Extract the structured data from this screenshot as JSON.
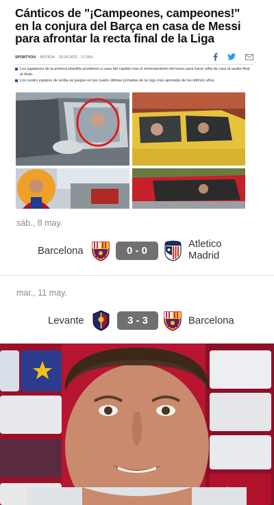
{
  "article": {
    "headline_lines": [
      "Cánticos de \"¡Campeones, campeones!\"",
      "en la conjura del Barça en casa de Messi",
      "para afrontar la recta final de la Liga"
    ],
    "source": "SPORTYOU",
    "category": "NOTICIA",
    "datetime": "03.05.2021 - 17:26H",
    "bullets": [
      "Los jugadores de la primera plantilla acudieron a casa del capitán tras el entrenamiento del lunes para hacer piña de cara al asalto final al título.",
      "Los cuatro equipos de arriba se juegan en las cuatro últimas jornadas de la Liga más apretada de los últimos años."
    ],
    "share_icons": [
      "facebook-icon",
      "twitter-icon",
      "mail-icon"
    ],
    "accent_color": "#1e4fa0"
  },
  "matches": [
    {
      "date": "sáb., 8 may.",
      "home": "Barcelona",
      "score": "0 - 0",
      "away_line1": "Atletico",
      "away_line2": "Madrid"
    },
    {
      "date": "mar., 11 may.",
      "home": "Levante",
      "score": "3 - 3",
      "away": "Barcelona"
    }
  ],
  "colors": {
    "score_bg": "#707070",
    "date_text": "#8a8a8a",
    "team_text": "#333333"
  }
}
